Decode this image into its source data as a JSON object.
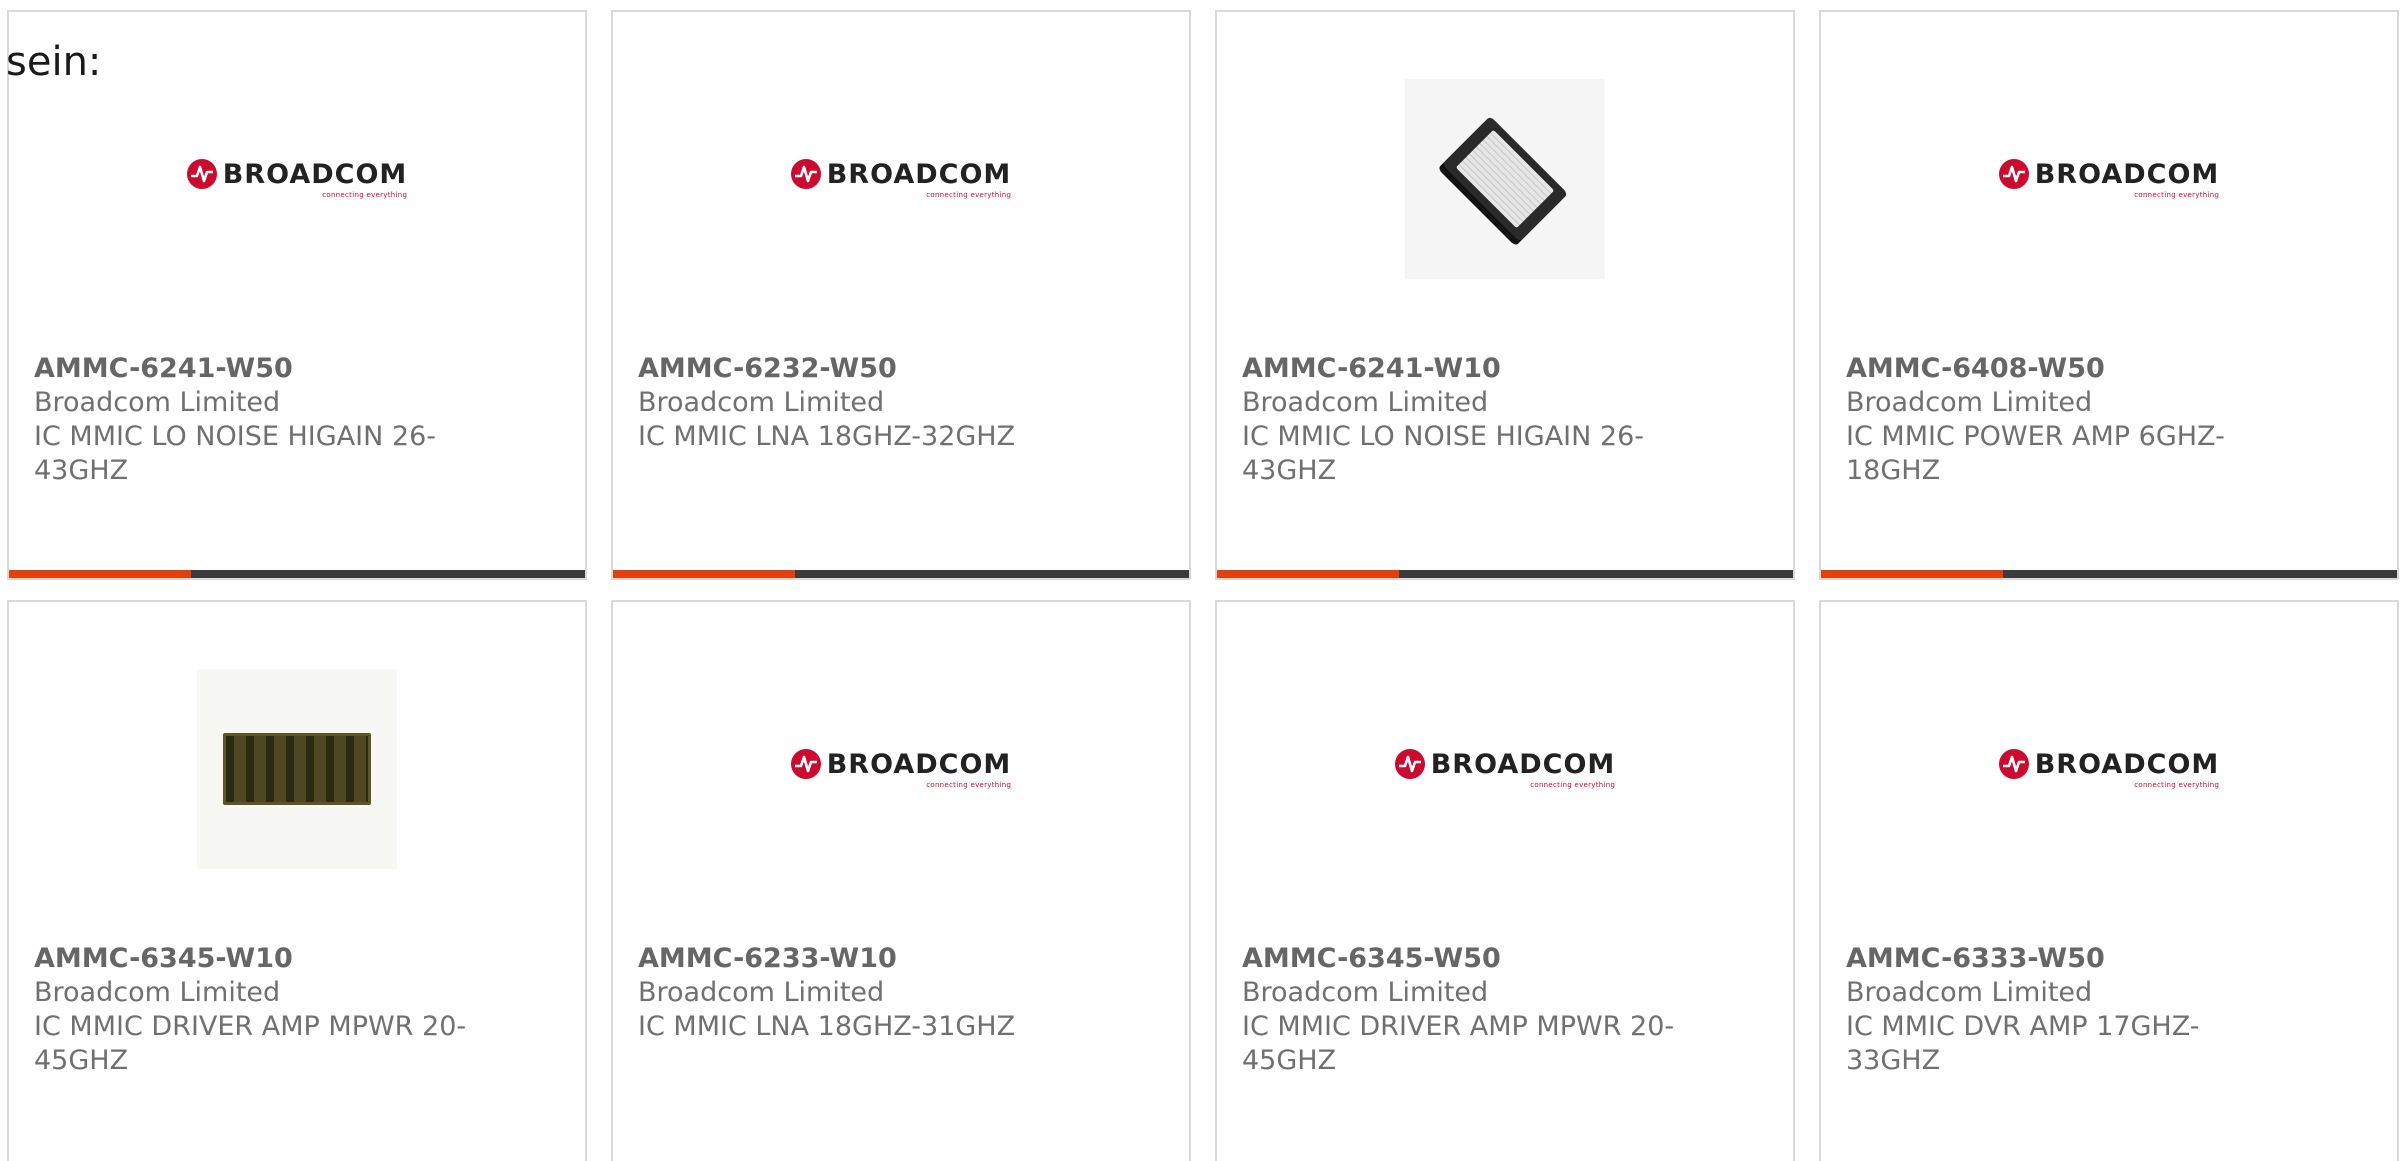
{
  "intro_text": "sein:",
  "logo": {
    "wordmark": "BROADCOM",
    "tagline": "connecting everything",
    "brand_color": "#cc092f"
  },
  "colors": {
    "accent_bar": "#e2410e",
    "bar_dark": "#3b3b3b"
  },
  "products": [
    {
      "part": "AMMC-6241-W50",
      "manufacturer": "Broadcom Limited",
      "description": "IC MMIC LO NOISE HIGAIN 26-43GHZ",
      "image": "broadcom-logo"
    },
    {
      "part": "AMMC-6232-W50",
      "manufacturer": "Broadcom Limited",
      "description": "IC MMIC LNA 18GHZ-32GHZ",
      "image": "broadcom-logo"
    },
    {
      "part": "AMMC-6241-W10",
      "manufacturer": "Broadcom Limited",
      "description": "IC MMIC LO NOISE HIGAIN 26-43GHZ",
      "image": "chip-package-photo"
    },
    {
      "part": "AMMC-6408-W50",
      "manufacturer": "Broadcom Limited",
      "description": "IC MMIC POWER AMP 6GHZ-18GHZ",
      "image": "broadcom-logo"
    },
    {
      "part": "AMMC-6345-W10",
      "manufacturer": "Broadcom Limited",
      "description": "IC MMIC DRIVER AMP MPWR 20-45GHZ",
      "image": "chip-die-photo"
    },
    {
      "part": "AMMC-6233-W10",
      "manufacturer": "Broadcom Limited",
      "description": "IC MMIC LNA 18GHZ-31GHZ",
      "image": "broadcom-logo"
    },
    {
      "part": "AMMC-6345-W50",
      "manufacturer": "Broadcom Limited",
      "description": "IC MMIC DRIVER AMP MPWR 20-45GHZ",
      "image": "broadcom-logo"
    },
    {
      "part": "AMMC-6333-W50",
      "manufacturer": "Broadcom Limited",
      "description": "IC MMIC DVR AMP 17GHZ-33GHZ",
      "image": "broadcom-logo"
    }
  ]
}
